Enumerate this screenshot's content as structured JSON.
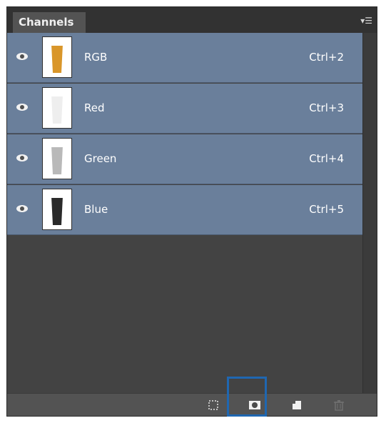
{
  "panel": {
    "tab_label": "Channels",
    "menu_icon": "panel-menu-icon"
  },
  "channels": [
    {
      "name": "RGB",
      "shortcut": "Ctrl+2",
      "visible": true,
      "thumb_color": "#d9962a"
    },
    {
      "name": "Red",
      "shortcut": "Ctrl+3",
      "visible": true,
      "thumb_color": "#eeeeee"
    },
    {
      "name": "Green",
      "shortcut": "Ctrl+4",
      "visible": true,
      "thumb_color": "#b9b9b9"
    },
    {
      "name": "Blue",
      "shortcut": "Ctrl+5",
      "visible": true,
      "thumb_color": "#2a2a2a"
    }
  ],
  "toolbar": {
    "buttons": [
      {
        "name": "load-channel-as-selection",
        "icon": "dotted-selection-icon"
      },
      {
        "name": "save-selection-as-channel",
        "icon": "mask-icon"
      },
      {
        "name": "create-new-channel",
        "icon": "new-channel-icon"
      },
      {
        "name": "delete-channel",
        "icon": "trash-icon"
      }
    ]
  },
  "colors": {
    "panel_bg": "#434343",
    "selected_row": "#6a7f9b",
    "highlight_border": "#1f67b1"
  }
}
